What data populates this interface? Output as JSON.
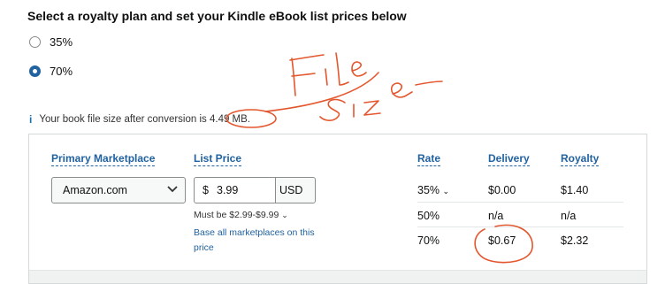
{
  "heading": "Select a royalty plan and set your Kindle eBook list prices below",
  "plans": [
    {
      "label": "35%",
      "checked": false
    },
    {
      "label": "70%",
      "checked": true
    }
  ],
  "info": {
    "icon": "info-icon",
    "text_before": "Your book file size after conversion is",
    "file_size": "4.49 MB",
    "text_after": "."
  },
  "table": {
    "headers": {
      "marketplace": "Primary Marketplace",
      "list_price": "List Price",
      "rate": "Rate",
      "delivery": "Delivery",
      "royalty": "Royalty"
    },
    "marketplace_value": "Amazon.com",
    "price": {
      "currency_symbol": "$",
      "value": "3.99",
      "unit": "USD"
    },
    "price_range": "Must be $2.99-$9.99",
    "base_link": "Base all marketplaces on this price",
    "rows": [
      {
        "rate": "35%",
        "delivery": "$0.00",
        "royalty": "$1.40"
      },
      {
        "rate": "50%",
        "delivery": "n/a",
        "royalty": "n/a"
      },
      {
        "rate": "70%",
        "delivery": "$0.67",
        "royalty": "$2.32"
      }
    ]
  },
  "colors": {
    "link": "#2162a1",
    "annotation": "#e4572e"
  }
}
